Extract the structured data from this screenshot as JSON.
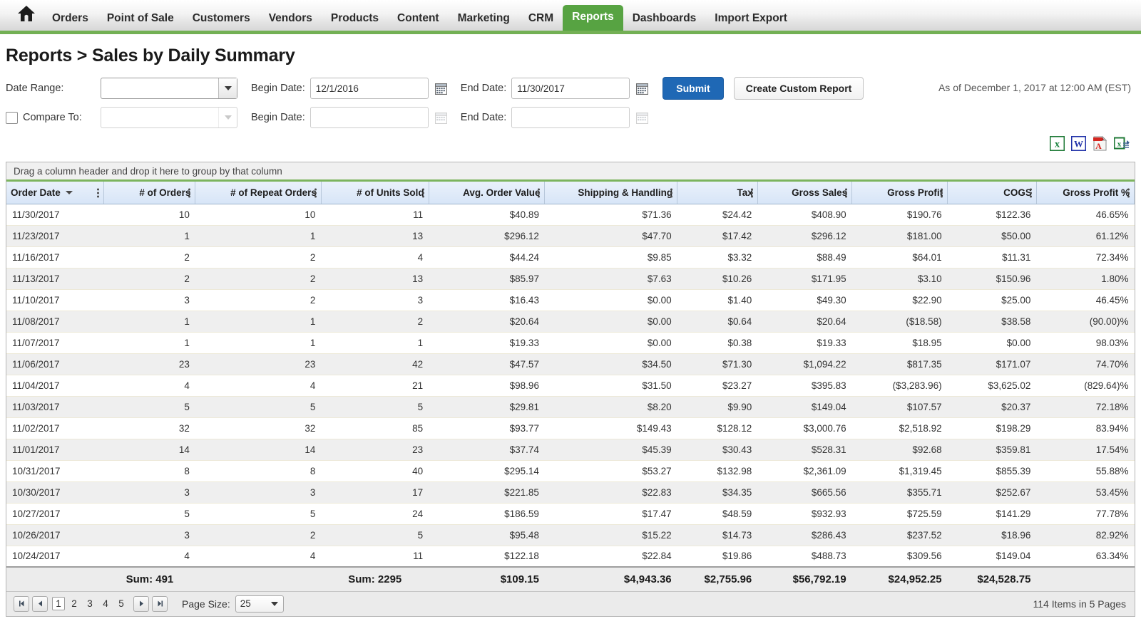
{
  "nav": {
    "home_icon": "home-icon",
    "items": [
      {
        "label": "Orders",
        "active": false
      },
      {
        "label": "Point of Sale",
        "active": false
      },
      {
        "label": "Customers",
        "active": false
      },
      {
        "label": "Vendors",
        "active": false
      },
      {
        "label": "Products",
        "active": false
      },
      {
        "label": "Content",
        "active": false
      },
      {
        "label": "Marketing",
        "active": false
      },
      {
        "label": "CRM",
        "active": false
      },
      {
        "label": "Reports",
        "active": true
      },
      {
        "label": "Dashboards",
        "active": false
      },
      {
        "label": "Import Export",
        "active": false
      }
    ],
    "active_color": "#57a342",
    "underline_color": "#73b054"
  },
  "page": {
    "title": "Reports > Sales by Daily Summary"
  },
  "filters": {
    "date_range_label": "Date Range:",
    "date_range_value": "",
    "begin_date_label": "Begin Date:",
    "begin_date_value": "12/1/2016",
    "end_date_label": "End Date:",
    "end_date_value": "11/30/2017",
    "compare_to_label": "Compare To:",
    "compare_range_value": "",
    "compare_begin_label": "Begin Date:",
    "compare_begin_value": "",
    "compare_end_label": "End Date:",
    "compare_end_value": "",
    "submit_label": "Submit",
    "custom_report_label": "Create Custom Report",
    "as_of": "As of December 1, 2017 at 12:00 AM (EST)",
    "submit_color": "#1f68b5"
  },
  "exports": [
    {
      "name": "export-excel-icon",
      "title": "Excel"
    },
    {
      "name": "export-word-icon",
      "title": "Word"
    },
    {
      "name": "export-pdf-icon",
      "title": "PDF"
    },
    {
      "name": "export-csv-icon",
      "title": "CSV"
    }
  ],
  "grid": {
    "group_hint": "Drag a column header and drop it here to group by that column",
    "sort_column": "Order Date",
    "sort_direction": "desc",
    "columns": [
      {
        "label": "Order Date",
        "align": "left",
        "width": "9.0%"
      },
      {
        "label": "# of Orders",
        "align": "right",
        "width": "8.4%"
      },
      {
        "label": "# of Repeat Orders",
        "align": "right",
        "width": "11.6%"
      },
      {
        "label": "# of Units Sold",
        "align": "right",
        "width": "9.9%"
      },
      {
        "label": "Avg. Order Value",
        "align": "right",
        "width": "10.7%"
      },
      {
        "label": "Shipping & Handling",
        "align": "right",
        "width": "12.2%"
      },
      {
        "label": "Tax",
        "align": "right",
        "width": "7.4%"
      },
      {
        "label": "Gross Sales",
        "align": "right",
        "width": "8.7%"
      },
      {
        "label": "Gross Profit",
        "align": "right",
        "width": "8.8%"
      },
      {
        "label": "COGS",
        "align": "right",
        "width": "8.2%"
      },
      {
        "label": "Gross Profit %",
        "align": "right",
        "width": "9.0%"
      }
    ],
    "rows": [
      [
        "11/30/2017",
        "10",
        "10",
        "11",
        "$40.89",
        "$71.36",
        "$24.42",
        "$408.90",
        "$190.76",
        "$122.36",
        "46.65%"
      ],
      [
        "11/23/2017",
        "1",
        "1",
        "13",
        "$296.12",
        "$47.70",
        "$17.42",
        "$296.12",
        "$181.00",
        "$50.00",
        "61.12%"
      ],
      [
        "11/16/2017",
        "2",
        "2",
        "4",
        "$44.24",
        "$9.85",
        "$3.32",
        "$88.49",
        "$64.01",
        "$11.31",
        "72.34%"
      ],
      [
        "11/13/2017",
        "2",
        "2",
        "13",
        "$85.97",
        "$7.63",
        "$10.26",
        "$171.95",
        "$3.10",
        "$150.96",
        "1.80%"
      ],
      [
        "11/10/2017",
        "3",
        "2",
        "3",
        "$16.43",
        "$0.00",
        "$1.40",
        "$49.30",
        "$22.90",
        "$25.00",
        "46.45%"
      ],
      [
        "11/08/2017",
        "1",
        "1",
        "2",
        "$20.64",
        "$0.00",
        "$0.64",
        "$20.64",
        "($18.58)",
        "$38.58",
        "(90.00)%"
      ],
      [
        "11/07/2017",
        "1",
        "1",
        "1",
        "$19.33",
        "$0.00",
        "$0.38",
        "$19.33",
        "$18.95",
        "$0.00",
        "98.03%"
      ],
      [
        "11/06/2017",
        "23",
        "23",
        "42",
        "$47.57",
        "$34.50",
        "$71.30",
        "$1,094.22",
        "$817.35",
        "$171.07",
        "74.70%"
      ],
      [
        "11/04/2017",
        "4",
        "4",
        "21",
        "$98.96",
        "$31.50",
        "$23.27",
        "$395.83",
        "($3,283.96)",
        "$3,625.02",
        "(829.64)%"
      ],
      [
        "11/03/2017",
        "5",
        "5",
        "5",
        "$29.81",
        "$8.20",
        "$9.90",
        "$149.04",
        "$107.57",
        "$20.37",
        "72.18%"
      ],
      [
        "11/02/2017",
        "32",
        "32",
        "85",
        "$93.77",
        "$149.43",
        "$128.12",
        "$3,000.76",
        "$2,518.92",
        "$198.29",
        "83.94%"
      ],
      [
        "11/01/2017",
        "14",
        "14",
        "23",
        "$37.74",
        "$45.39",
        "$30.43",
        "$528.31",
        "$92.68",
        "$359.81",
        "17.54%"
      ],
      [
        "10/31/2017",
        "8",
        "8",
        "40",
        "$295.14",
        "$53.27",
        "$132.98",
        "$2,361.09",
        "$1,319.45",
        "$855.39",
        "55.88%"
      ],
      [
        "10/30/2017",
        "3",
        "3",
        "17",
        "$221.85",
        "$22.83",
        "$34.35",
        "$665.56",
        "$355.71",
        "$252.67",
        "53.45%"
      ],
      [
        "10/27/2017",
        "5",
        "5",
        "24",
        "$186.59",
        "$17.47",
        "$48.59",
        "$932.93",
        "$725.59",
        "$141.29",
        "77.78%"
      ],
      [
        "10/26/2017",
        "3",
        "2",
        "5",
        "$95.48",
        "$15.22",
        "$14.73",
        "$286.43",
        "$237.52",
        "$18.96",
        "82.92%"
      ],
      [
        "10/24/2017",
        "4",
        "4",
        "11",
        "$122.18",
        "$22.84",
        "$19.86",
        "$488.73",
        "$309.56",
        "$149.04",
        "63.34%"
      ]
    ],
    "summary": [
      "",
      "Sum: 491",
      "",
      "Sum: 2295",
      "$109.15",
      "$4,943.36",
      "$2,755.96",
      "$56,792.19",
      "$24,952.25",
      "$24,528.75",
      ""
    ]
  },
  "pager": {
    "first_icon": "first-page-icon",
    "prev_icon": "previous-page-icon",
    "next_icon": "next-page-icon",
    "last_icon": "last-page-icon",
    "pages": [
      "1",
      "2",
      "3",
      "4",
      "5"
    ],
    "current_page": "1",
    "page_size_label": "Page Size:",
    "page_size_value": "25",
    "item_count": "114 Items in 5 Pages"
  }
}
